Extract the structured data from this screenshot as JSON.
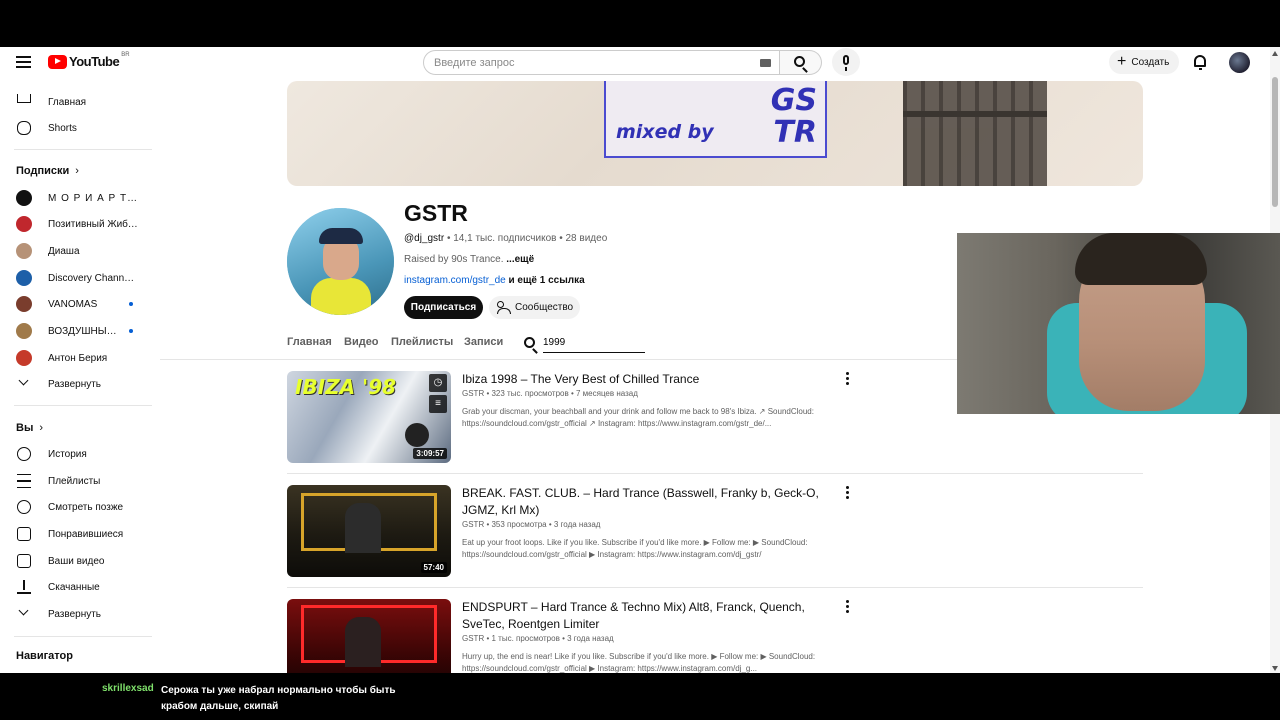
{
  "header": {
    "logo_text": "YouTube",
    "logo_country": "BR",
    "search_placeholder": "Введите запрос",
    "create_label": "Создать"
  },
  "sidebar": {
    "main": [
      {
        "label": "Главная",
        "icon": "home-icon"
      },
      {
        "label": "Shorts",
        "icon": "shorts-icon"
      }
    ],
    "subscriptions_title": "Подписки",
    "subscriptions": [
      {
        "label": "М О Р И А Р Т И",
        "color": "#111111",
        "dot": false
      },
      {
        "label": "Позитивный Жибер",
        "color": "#c0272d",
        "dot": false
      },
      {
        "label": "Диаша",
        "color": "#b69277",
        "dot": false
      },
      {
        "label": "Discovery Channel ...",
        "color": "#1d5fa8",
        "dot": false
      },
      {
        "label": "VANOMAS",
        "color": "#7a3d2d",
        "dot": true
      },
      {
        "label": "ВОЗДУШНЫЙ ...",
        "color": "#a07a4a",
        "dot": true
      },
      {
        "label": "Антон Берия",
        "color": "#c53a2a",
        "dot": false
      }
    ],
    "subs_expand": "Развернуть",
    "you_title": "Вы",
    "you_items": [
      {
        "label": "История",
        "icon": "history-icon"
      },
      {
        "label": "Плейлисты",
        "icon": "playlists-icon"
      },
      {
        "label": "Смотреть позже",
        "icon": "watch-later-icon"
      },
      {
        "label": "Понравившиеся",
        "icon": "like-icon"
      },
      {
        "label": "Ваши видео",
        "icon": "your-videos-icon"
      },
      {
        "label": "Скачанные",
        "icon": "downloads-icon"
      }
    ],
    "you_expand": "Развернуть",
    "navigator_title": "Навигатор"
  },
  "banner": {
    "mixed_by": "mixed by",
    "gs_line1": "GS",
    "gs_line2": "TR"
  },
  "channel": {
    "name": "GSTR",
    "handle": "@dj_gstr",
    "subscribers": "14,1 тыс. подписчиков",
    "videos_count": "28 видео",
    "description": "Raised by 90s Trance.",
    "more": "...ещё",
    "link": "instagram.com/gstr_de",
    "link_extra": "и ещё 1 ссылка",
    "subscribe_label": "Подписаться",
    "community_label": "Сообщество"
  },
  "tabs": [
    "Главная",
    "Видео",
    "Плейлисты",
    "Записи"
  ],
  "tab_search_value": "1999",
  "videos": [
    {
      "title": "Ibiza 1998 – The Very Best of Chilled Trance",
      "channel": "GSTR",
      "views": "323 тыс. просмотров",
      "age": "7 месяцев назад",
      "desc_line1": "Grab your discman, your beachball and your drink and follow me back to 98's Ibiza. ↗ SoundCloud:",
      "desc_line2": "https://soundcloud.com/gstr_official ↗ Instagram: https://www.instagram.com/gstr_de/...",
      "duration": "3:09:57",
      "thumb_text": "IBIZA '98"
    },
    {
      "title": "BREAK. FAST. CLUB. – Hard Trance (Basswell, Franky b, Geck-O, JGMZ, Krl Mx)",
      "channel": "GSTR",
      "views": "353 просмотра",
      "age": "3 года назад",
      "desc_line1": "Eat up your froot loops. Like if you like. Subscribe if you'd like more. ▶ Follow me: ▶ SoundCloud:",
      "desc_line2": "https://soundcloud.com/gstr_official ▶ Instagram: https://www.instagram.com/dj_gstr/",
      "duration": "57:40"
    },
    {
      "title": "ENDSPURT – Hard Trance & Techno Mix) Alt8, Franck, Quench, SveTec, Roentgen Limiter",
      "channel": "GSTR",
      "views": "1 тыс. просмотров",
      "age": "3 года назад",
      "desc_line1": "Hurry up, the end is near! Like if you like. Subscribe if you'd like more. ▶ Follow me: ▶ SoundCloud:",
      "desc_line2": "https://soundcloud.com/gstr_official ▶ Instagram: https://www.instagram.com/dj_g..."
    }
  ],
  "chat": {
    "user": "skrillexsad",
    "message": "Серожа ты уже набрал нормально чтобы быть крабом дальше, скипай"
  }
}
